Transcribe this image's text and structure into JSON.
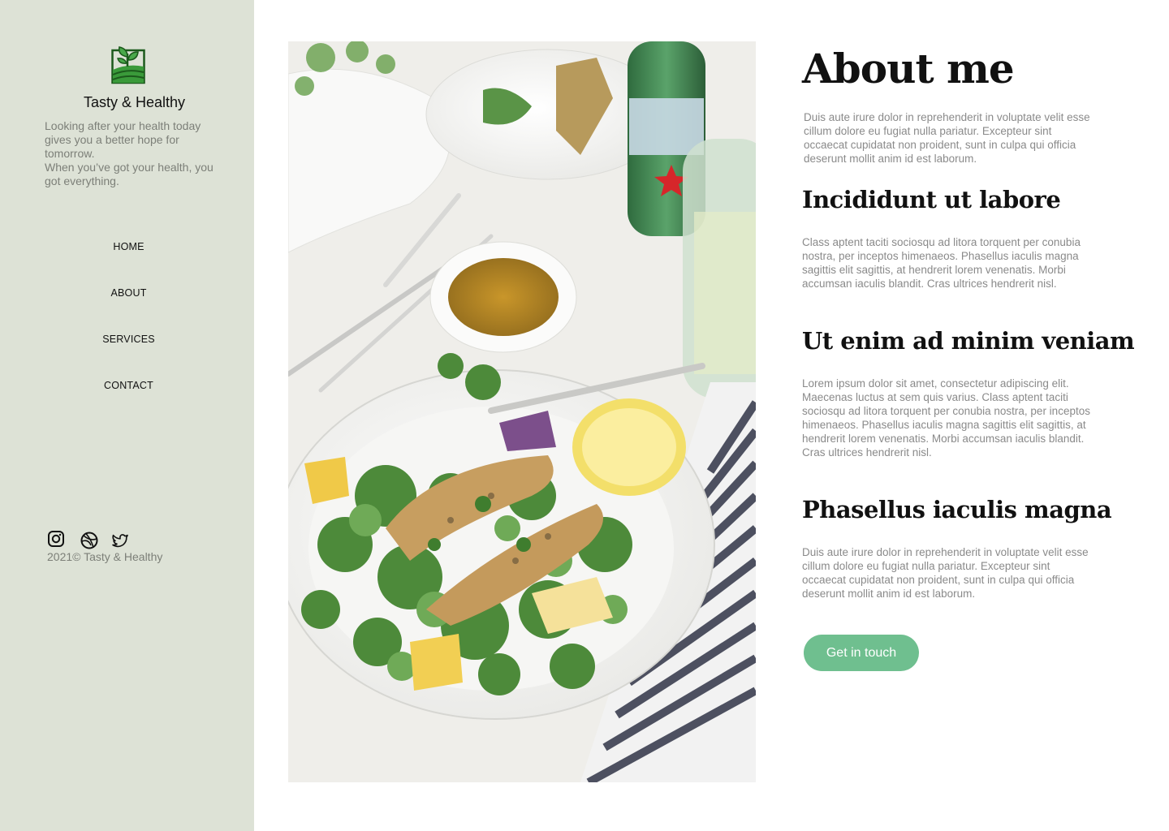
{
  "brand": {
    "name": "Tasty & Healthy",
    "logo_icon": "leaf-field-logo",
    "tagline_lines": [
      "Looking after your health today gives you a better hope for tomorrow.",
      "When you’ve got your health, you got everything."
    ]
  },
  "nav": {
    "items": [
      {
        "label": "HOME"
      },
      {
        "label": "ABOUT"
      },
      {
        "label": "SERVICES"
      },
      {
        "label": "CONTACT"
      }
    ]
  },
  "social": {
    "icons": [
      "instagram-icon",
      "dribbble-icon",
      "twitter-icon"
    ]
  },
  "footer": {
    "copyright": "2021© Tasty & Healthy"
  },
  "main": {
    "title": "About me",
    "intro": "Duis aute irure dolor in reprehenderit in voluptate velit esse cillum dolore eu fugiat nulla pariatur. Excepteur sint occaecat cupidatat non proident, sunt in culpa qui officia deserunt mollit anim id est laborum.",
    "sections": [
      {
        "heading": "Incididunt ut labore",
        "text": "Class aptent taciti sociosqu ad litora torquent per conubia nostra, per inceptos himenaeos. Phasellus iaculis magna sagittis elit sagittis, at hendrerit lorem venenatis. Morbi accumsan iaculis blandit. Cras ultrices hendrerit nisl."
      },
      {
        "heading": "Ut enim ad minim veniam",
        "text": "Lorem ipsum dolor sit amet, consectetur adipiscing elit. Maecenas luctus at sem quis varius. Class aptent taciti sociosqu ad litora torquent per conubia nostra, per inceptos himenaeos. Phasellus iaculis magna sagittis elit sagittis, at hendrerit lorem venenatis. Morbi accumsan iaculis blandit. Cras ultrices hendrerit nisl."
      },
      {
        "heading": "Phasellus iaculis magna",
        "text": "Duis aute irure dolor in reprehenderit in voluptate velit esse cillum dolore eu fugiat nulla pariatur. Excepteur sint occaecat cupidatat non proident, sunt in culpa qui officia deserunt mollit anim id est laborum."
      }
    ],
    "cta_label": "Get in touch"
  },
  "colors": {
    "sidebar_bg": "#dde2d6",
    "accent_green": "#6fbf8f",
    "logo_green": "#2e8a2e",
    "muted_text": "#8a8a8a"
  }
}
